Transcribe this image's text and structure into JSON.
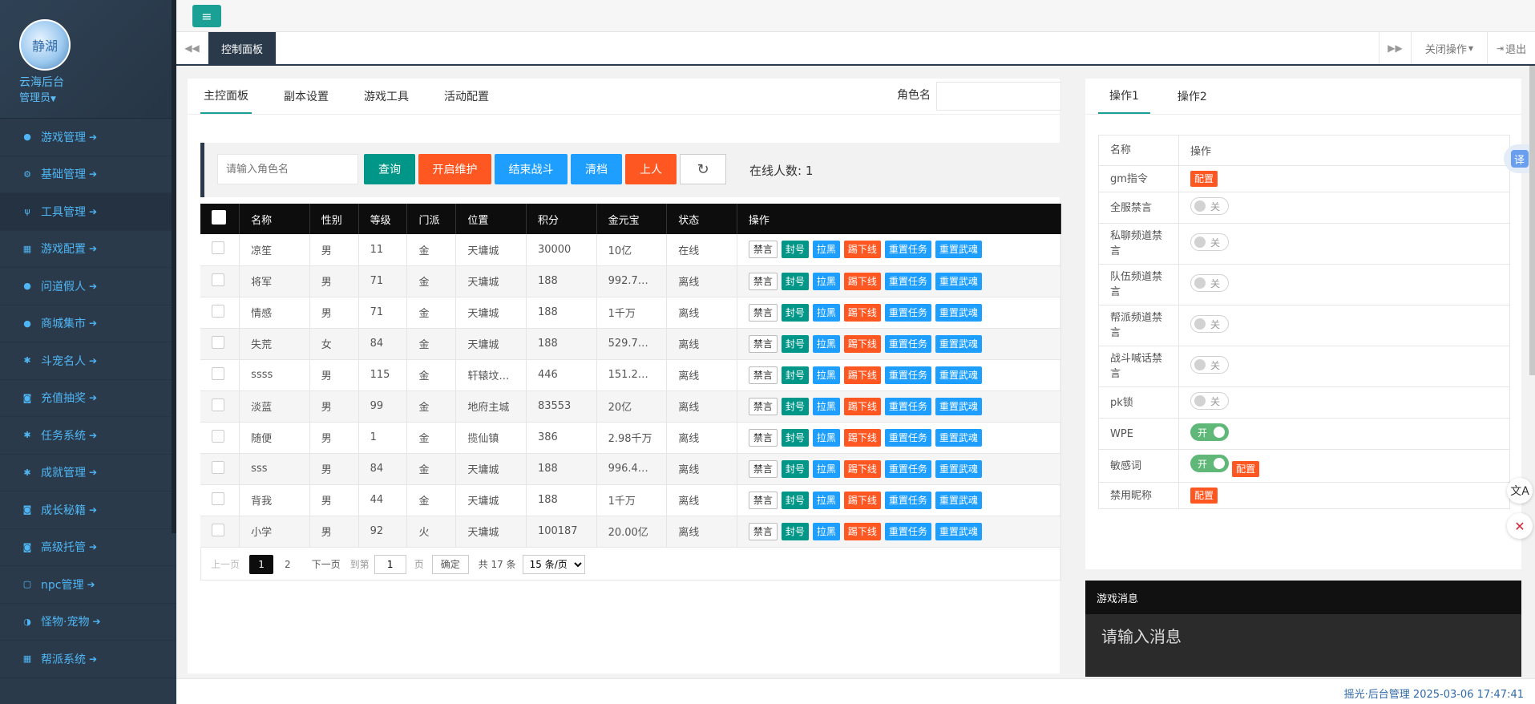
{
  "sidebar": {
    "avatar_text": "静湖",
    "brand": "云海后台",
    "role": "管理员",
    "items": [
      {
        "label": "游戏管理",
        "icon": "user-icon"
      },
      {
        "label": "基础管理",
        "icon": "cogs-icon"
      },
      {
        "label": "工具管理",
        "icon": "cutlery-icon"
      },
      {
        "label": "游戏配置",
        "icon": "grid-icon"
      },
      {
        "label": "问道假人",
        "icon": "user-icon"
      },
      {
        "label": "商城集市",
        "icon": "user-icon"
      },
      {
        "label": "斗宠名人",
        "icon": "gear-icon"
      },
      {
        "label": "充值抽奖",
        "icon": "camera-icon"
      },
      {
        "label": "任务系统",
        "icon": "gear-icon"
      },
      {
        "label": "成就管理",
        "icon": "gear-icon"
      },
      {
        "label": "成长秘籍",
        "icon": "camera-icon"
      },
      {
        "label": "高级托管",
        "icon": "camera-icon"
      },
      {
        "label": "npc管理",
        "icon": "square-icon"
      },
      {
        "label": "怪物·宠物",
        "icon": "half-circle-icon"
      },
      {
        "label": "帮派系统",
        "icon": "grid-icon"
      }
    ]
  },
  "header": {
    "tab_active": "控制面板",
    "close_ops": "关闭操作",
    "logout": "退出"
  },
  "main": {
    "tabs": [
      "主控面板",
      "副本设置",
      "游戏工具",
      "活动配置"
    ],
    "role_label": "角色名",
    "search_placeholder": "请输入角色名",
    "buttons": {
      "query": "查询",
      "maintenance": "开启维护",
      "end_battle": "结束战斗",
      "clear_file": "清档",
      "online": "上人"
    },
    "online_count": "在线人数: 1",
    "columns": [
      "名称",
      "性别",
      "等级",
      "门派",
      "位置",
      "积分",
      "金元宝",
      "状态",
      "操作"
    ],
    "actions": [
      "禁言",
      "封号",
      "拉黑",
      "踢下线",
      "重置任务",
      "重置武魂"
    ],
    "rows": [
      {
        "name": "凉笙",
        "gender": "男",
        "level": "11",
        "sect": "金",
        "location": "天墉城",
        "score": "30000",
        "gold": "10亿",
        "status": "在线"
      },
      {
        "name": "将军",
        "gender": "男",
        "level": "71",
        "sect": "金",
        "location": "天墉城",
        "score": "188",
        "gold": "992.7…",
        "status": "离线"
      },
      {
        "name": "情感",
        "gender": "男",
        "level": "71",
        "sect": "金",
        "location": "天墉城",
        "score": "188",
        "gold": "1千万",
        "status": "离线"
      },
      {
        "name": "失荒",
        "gender": "女",
        "level": "84",
        "sect": "金",
        "location": "天墉城",
        "score": "188",
        "gold": "529.7…",
        "status": "离线"
      },
      {
        "name": "ssss",
        "gender": "男",
        "level": "115",
        "sect": "金",
        "location": "轩辕坟…",
        "score": "446",
        "gold": "151.2…",
        "status": "离线"
      },
      {
        "name": "淡蓝",
        "gender": "男",
        "level": "99",
        "sect": "金",
        "location": "地府主城",
        "score": "83553",
        "gold": "20亿",
        "status": "离线"
      },
      {
        "name": "随便",
        "gender": "男",
        "level": "1",
        "sect": "金",
        "location": "揽仙镇",
        "score": "386",
        "gold": "2.98千万",
        "status": "离线"
      },
      {
        "name": "sss",
        "gender": "男",
        "level": "84",
        "sect": "金",
        "location": "天墉城",
        "score": "188",
        "gold": "996.4…",
        "status": "离线"
      },
      {
        "name": "背我",
        "gender": "男",
        "level": "44",
        "sect": "金",
        "location": "天墉城",
        "score": "188",
        "gold": "1千万",
        "status": "离线"
      },
      {
        "name": "小学",
        "gender": "男",
        "level": "92",
        "sect": "火",
        "location": "天墉城",
        "score": "100187",
        "gold": "20.00亿",
        "status": "离线"
      }
    ],
    "pager": {
      "prev": "上一页",
      "current": "1",
      "page2": "2",
      "next": "下一页",
      "goto": "到第",
      "goto_value": "1",
      "page_unit": "页",
      "confirm": "确定",
      "total": "共 17 条",
      "per_page": "15 条/页"
    }
  },
  "right": {
    "tabs": [
      "操作1",
      "操作2"
    ],
    "header": {
      "name": "名称",
      "op": "操作"
    },
    "config_label": "配置",
    "off_label": "关",
    "on_label": "开",
    "rows": [
      {
        "name": "gm指令",
        "type": "config"
      },
      {
        "name": "全服禁言",
        "type": "switch",
        "on": false
      },
      {
        "name": "私聊频道禁言",
        "type": "switch",
        "on": false
      },
      {
        "name": "队伍频道禁言",
        "type": "switch",
        "on": false
      },
      {
        "name": "帮派频道禁言",
        "type": "switch",
        "on": false
      },
      {
        "name": "战斗喊话禁言",
        "type": "switch",
        "on": false
      },
      {
        "name": "pk锁",
        "type": "switch",
        "on": false
      },
      {
        "name": "WPE",
        "type": "switch",
        "on": true,
        "red": true
      },
      {
        "name": "敏感词",
        "type": "switch_config",
        "on": true
      },
      {
        "name": "禁用昵称",
        "type": "config"
      }
    ]
  },
  "messages": {
    "title": "游戏消息",
    "placeholder": "请输入消息"
  },
  "footer": {
    "text": "摇光·后台管理 2025-03-06 17:47:41"
  },
  "floating": {
    "translate_label": "译"
  }
}
